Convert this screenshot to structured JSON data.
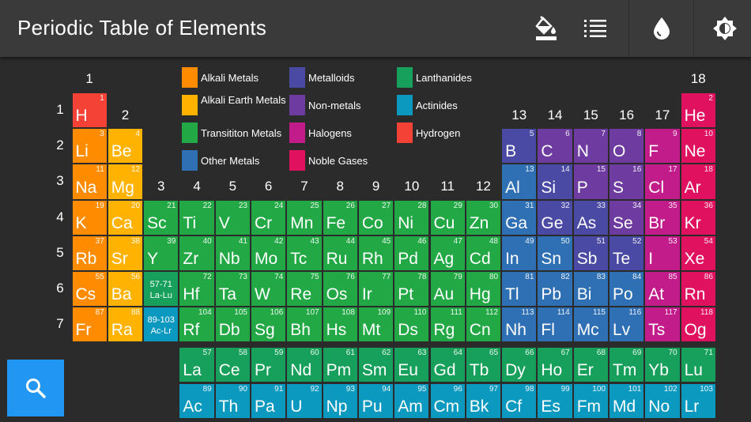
{
  "header": {
    "title": "Periodic Table of Elements",
    "buttons": [
      {
        "name": "paint-bucket-icon"
      },
      {
        "name": "list-icon"
      },
      {
        "name": "water-drop-icon"
      },
      {
        "name": "brightness-icon"
      }
    ]
  },
  "groups": [
    "1",
    "2",
    "3",
    "4",
    "5",
    "6",
    "7",
    "8",
    "9",
    "10",
    "11",
    "12",
    "13",
    "14",
    "15",
    "16",
    "17",
    "18"
  ],
  "periods": [
    "1",
    "2",
    "3",
    "4",
    "5",
    "6",
    "7"
  ],
  "colors": {
    "alkali": "#ff8c00",
    "alkaline": "#ffb300",
    "transition": "#22a845",
    "other": "#2f6fb3",
    "metalloid": "#4a4aa5",
    "nonmetal": "#6e3ca0",
    "halogen": "#c21b8a",
    "noble": "#e0115f",
    "lanthanide": "#16a05b",
    "actinide": "#0b99bf",
    "hydrogen": "#f44336"
  },
  "legend": [
    {
      "key": "alkali",
      "label": "Alkali Metals"
    },
    {
      "key": "alkaline",
      "label": "Alkali Earth Metals"
    },
    {
      "key": "transition",
      "label": "Transititon Metals"
    },
    {
      "key": "other",
      "label": "Other Metals"
    },
    {
      "key": "metalloid",
      "label": "Metalloids"
    },
    {
      "key": "nonmetal",
      "label": "Non-metals"
    },
    {
      "key": "halogen",
      "label": "Halogens"
    },
    {
      "key": "noble",
      "label": "Noble Gases"
    },
    {
      "key": "lanthanide",
      "label": "Lanthanides"
    },
    {
      "key": "actinide",
      "label": "Actinides"
    },
    {
      "key": "hydrogen",
      "label": "Hydrogen"
    }
  ],
  "refs": [
    {
      "line1": "57-71",
      "line2": "La-Lu",
      "cat": "lanthanide"
    },
    {
      "line1": "89-103",
      "line2": "Ac-Lr",
      "cat": "actinide"
    }
  ],
  "elements": [
    {
      "s": "H",
      "n": 1,
      "p": 1,
      "g": 1,
      "c": "hydrogen"
    },
    {
      "s": "He",
      "n": 2,
      "p": 1,
      "g": 18,
      "c": "noble"
    },
    {
      "s": "Li",
      "n": 3,
      "p": 2,
      "g": 1,
      "c": "alkali"
    },
    {
      "s": "Be",
      "n": 4,
      "p": 2,
      "g": 2,
      "c": "alkaline"
    },
    {
      "s": "B",
      "n": 5,
      "p": 2,
      "g": 13,
      "c": "metalloid"
    },
    {
      "s": "C",
      "n": 6,
      "p": 2,
      "g": 14,
      "c": "nonmetal"
    },
    {
      "s": "N",
      "n": 7,
      "p": 2,
      "g": 15,
      "c": "nonmetal"
    },
    {
      "s": "O",
      "n": 8,
      "p": 2,
      "g": 16,
      "c": "nonmetal"
    },
    {
      "s": "F",
      "n": 9,
      "p": 2,
      "g": 17,
      "c": "halogen"
    },
    {
      "s": "Ne",
      "n": 10,
      "p": 2,
      "g": 18,
      "c": "noble"
    },
    {
      "s": "Na",
      "n": 11,
      "p": 3,
      "g": 1,
      "c": "alkali"
    },
    {
      "s": "Mg",
      "n": 12,
      "p": 3,
      "g": 2,
      "c": "alkaline"
    },
    {
      "s": "Al",
      "n": 13,
      "p": 3,
      "g": 13,
      "c": "other"
    },
    {
      "s": "Si",
      "n": 14,
      "p": 3,
      "g": 14,
      "c": "metalloid"
    },
    {
      "s": "P",
      "n": 15,
      "p": 3,
      "g": 15,
      "c": "nonmetal"
    },
    {
      "s": "S",
      "n": 16,
      "p": 3,
      "g": 16,
      "c": "nonmetal"
    },
    {
      "s": "Cl",
      "n": 17,
      "p": 3,
      "g": 17,
      "c": "halogen"
    },
    {
      "s": "Ar",
      "n": 18,
      "p": 3,
      "g": 18,
      "c": "noble"
    },
    {
      "s": "K",
      "n": 19,
      "p": 4,
      "g": 1,
      "c": "alkali"
    },
    {
      "s": "Ca",
      "n": 20,
      "p": 4,
      "g": 2,
      "c": "alkaline"
    },
    {
      "s": "Sc",
      "n": 21,
      "p": 4,
      "g": 3,
      "c": "transition"
    },
    {
      "s": "Ti",
      "n": 22,
      "p": 4,
      "g": 4,
      "c": "transition"
    },
    {
      "s": "V",
      "n": 23,
      "p": 4,
      "g": 5,
      "c": "transition"
    },
    {
      "s": "Cr",
      "n": 24,
      "p": 4,
      "g": 6,
      "c": "transition"
    },
    {
      "s": "Mn",
      "n": 25,
      "p": 4,
      "g": 7,
      "c": "transition"
    },
    {
      "s": "Fe",
      "n": 26,
      "p": 4,
      "g": 8,
      "c": "transition"
    },
    {
      "s": "Co",
      "n": 27,
      "p": 4,
      "g": 9,
      "c": "transition"
    },
    {
      "s": "Ni",
      "n": 28,
      "p": 4,
      "g": 10,
      "c": "transition"
    },
    {
      "s": "Cu",
      "n": 29,
      "p": 4,
      "g": 11,
      "c": "transition"
    },
    {
      "s": "Zn",
      "n": 30,
      "p": 4,
      "g": 12,
      "c": "transition"
    },
    {
      "s": "Ga",
      "n": 31,
      "p": 4,
      "g": 13,
      "c": "other"
    },
    {
      "s": "Ge",
      "n": 32,
      "p": 4,
      "g": 14,
      "c": "metalloid"
    },
    {
      "s": "As",
      "n": 33,
      "p": 4,
      "g": 15,
      "c": "metalloid"
    },
    {
      "s": "Se",
      "n": 34,
      "p": 4,
      "g": 16,
      "c": "nonmetal"
    },
    {
      "s": "Br",
      "n": 35,
      "p": 4,
      "g": 17,
      "c": "halogen"
    },
    {
      "s": "Kr",
      "n": 36,
      "p": 4,
      "g": 18,
      "c": "noble"
    },
    {
      "s": "Rb",
      "n": 37,
      "p": 5,
      "g": 1,
      "c": "alkali"
    },
    {
      "s": "Sr",
      "n": 38,
      "p": 5,
      "g": 2,
      "c": "alkaline"
    },
    {
      "s": "Y",
      "n": 39,
      "p": 5,
      "g": 3,
      "c": "transition"
    },
    {
      "s": "Zr",
      "n": 40,
      "p": 5,
      "g": 4,
      "c": "transition"
    },
    {
      "s": "Nb",
      "n": 41,
      "p": 5,
      "g": 5,
      "c": "transition"
    },
    {
      "s": "Mo",
      "n": 42,
      "p": 5,
      "g": 6,
      "c": "transition"
    },
    {
      "s": "Tc",
      "n": 43,
      "p": 5,
      "g": 7,
      "c": "transition"
    },
    {
      "s": "Ru",
      "n": 44,
      "p": 5,
      "g": 8,
      "c": "transition"
    },
    {
      "s": "Rh",
      "n": 45,
      "p": 5,
      "g": 9,
      "c": "transition"
    },
    {
      "s": "Pd",
      "n": 46,
      "p": 5,
      "g": 10,
      "c": "transition"
    },
    {
      "s": "Ag",
      "n": 47,
      "p": 5,
      "g": 11,
      "c": "transition"
    },
    {
      "s": "Cd",
      "n": 48,
      "p": 5,
      "g": 12,
      "c": "transition"
    },
    {
      "s": "In",
      "n": 49,
      "p": 5,
      "g": 13,
      "c": "other"
    },
    {
      "s": "Sn",
      "n": 50,
      "p": 5,
      "g": 14,
      "c": "other"
    },
    {
      "s": "Sb",
      "n": 51,
      "p": 5,
      "g": 15,
      "c": "metalloid"
    },
    {
      "s": "Te",
      "n": 52,
      "p": 5,
      "g": 16,
      "c": "metalloid"
    },
    {
      "s": "I",
      "n": 53,
      "p": 5,
      "g": 17,
      "c": "halogen"
    },
    {
      "s": "Xe",
      "n": 54,
      "p": 5,
      "g": 18,
      "c": "noble"
    },
    {
      "s": "Cs",
      "n": 55,
      "p": 6,
      "g": 1,
      "c": "alkali"
    },
    {
      "s": "Ba",
      "n": 56,
      "p": 6,
      "g": 2,
      "c": "alkaline"
    },
    {
      "s": "Hf",
      "n": 72,
      "p": 6,
      "g": 4,
      "c": "transition"
    },
    {
      "s": "Ta",
      "n": 73,
      "p": 6,
      "g": 5,
      "c": "transition"
    },
    {
      "s": "W",
      "n": 74,
      "p": 6,
      "g": 6,
      "c": "transition"
    },
    {
      "s": "Re",
      "n": 75,
      "p": 6,
      "g": 7,
      "c": "transition"
    },
    {
      "s": "Os",
      "n": 76,
      "p": 6,
      "g": 8,
      "c": "transition"
    },
    {
      "s": "Ir",
      "n": 77,
      "p": 6,
      "g": 9,
      "c": "transition"
    },
    {
      "s": "Pt",
      "n": 78,
      "p": 6,
      "g": 10,
      "c": "transition"
    },
    {
      "s": "Au",
      "n": 79,
      "p": 6,
      "g": 11,
      "c": "transition"
    },
    {
      "s": "Hg",
      "n": 80,
      "p": 6,
      "g": 12,
      "c": "transition"
    },
    {
      "s": "Tl",
      "n": 81,
      "p": 6,
      "g": 13,
      "c": "other"
    },
    {
      "s": "Pb",
      "n": 82,
      "p": 6,
      "g": 14,
      "c": "other"
    },
    {
      "s": "Bi",
      "n": 83,
      "p": 6,
      "g": 15,
      "c": "other"
    },
    {
      "s": "Po",
      "n": 84,
      "p": 6,
      "g": 16,
      "c": "other"
    },
    {
      "s": "At",
      "n": 85,
      "p": 6,
      "g": 17,
      "c": "halogen"
    },
    {
      "s": "Rn",
      "n": 86,
      "p": 6,
      "g": 18,
      "c": "noble"
    },
    {
      "s": "Fr",
      "n": 87,
      "p": 7,
      "g": 1,
      "c": "alkali"
    },
    {
      "s": "Ra",
      "n": 88,
      "p": 7,
      "g": 2,
      "c": "alkaline"
    },
    {
      "s": "Rf",
      "n": 104,
      "p": 7,
      "g": 4,
      "c": "transition"
    },
    {
      "s": "Db",
      "n": 105,
      "p": 7,
      "g": 5,
      "c": "transition"
    },
    {
      "s": "Sg",
      "n": 106,
      "p": 7,
      "g": 6,
      "c": "transition"
    },
    {
      "s": "Bh",
      "n": 107,
      "p": 7,
      "g": 7,
      "c": "transition"
    },
    {
      "s": "Hs",
      "n": 108,
      "p": 7,
      "g": 8,
      "c": "transition"
    },
    {
      "s": "Mt",
      "n": 109,
      "p": 7,
      "g": 9,
      "c": "transition"
    },
    {
      "s": "Ds",
      "n": 110,
      "p": 7,
      "g": 10,
      "c": "transition"
    },
    {
      "s": "Rg",
      "n": 111,
      "p": 7,
      "g": 11,
      "c": "transition"
    },
    {
      "s": "Cn",
      "n": 112,
      "p": 7,
      "g": 12,
      "c": "transition"
    },
    {
      "s": "Nh",
      "n": 113,
      "p": 7,
      "g": 13,
      "c": "other"
    },
    {
      "s": "Fl",
      "n": 114,
      "p": 7,
      "g": 14,
      "c": "other"
    },
    {
      "s": "Mc",
      "n": 115,
      "p": 7,
      "g": 15,
      "c": "other"
    },
    {
      "s": "Lv",
      "n": 116,
      "p": 7,
      "g": 16,
      "c": "other"
    },
    {
      "s": "Ts",
      "n": 117,
      "p": 7,
      "g": 17,
      "c": "halogen"
    },
    {
      "s": "Og",
      "n": 118,
      "p": 7,
      "g": 18,
      "c": "noble"
    }
  ],
  "lanthanides": [
    {
      "s": "La",
      "n": 57
    },
    {
      "s": "Ce",
      "n": 58
    },
    {
      "s": "Pr",
      "n": 59
    },
    {
      "s": "Nd",
      "n": 60
    },
    {
      "s": "Pm",
      "n": 61
    },
    {
      "s": "Sm",
      "n": 62
    },
    {
      "s": "Eu",
      "n": 63
    },
    {
      "s": "Gd",
      "n": 64
    },
    {
      "s": "Tb",
      "n": 65
    },
    {
      "s": "Dy",
      "n": 66
    },
    {
      "s": "Ho",
      "n": 67
    },
    {
      "s": "Er",
      "n": 68
    },
    {
      "s": "Tm",
      "n": 69
    },
    {
      "s": "Yb",
      "n": 70
    },
    {
      "s": "Lu",
      "n": 71
    }
  ],
  "actinides": [
    {
      "s": "Ac",
      "n": 89
    },
    {
      "s": "Th",
      "n": 90
    },
    {
      "s": "Pa",
      "n": 91
    },
    {
      "s": "U",
      "n": 92
    },
    {
      "s": "Np",
      "n": 93
    },
    {
      "s": "Pu",
      "n": 94
    },
    {
      "s": "Am",
      "n": 95
    },
    {
      "s": "Cm",
      "n": 96
    },
    {
      "s": "Bk",
      "n": 97
    },
    {
      "s": "Cf",
      "n": 98
    },
    {
      "s": "Es",
      "n": 99
    },
    {
      "s": "Fm",
      "n": 100
    },
    {
      "s": "Md",
      "n": 101
    },
    {
      "s": "No",
      "n": 102
    },
    {
      "s": "Lr",
      "n": 103
    }
  ]
}
